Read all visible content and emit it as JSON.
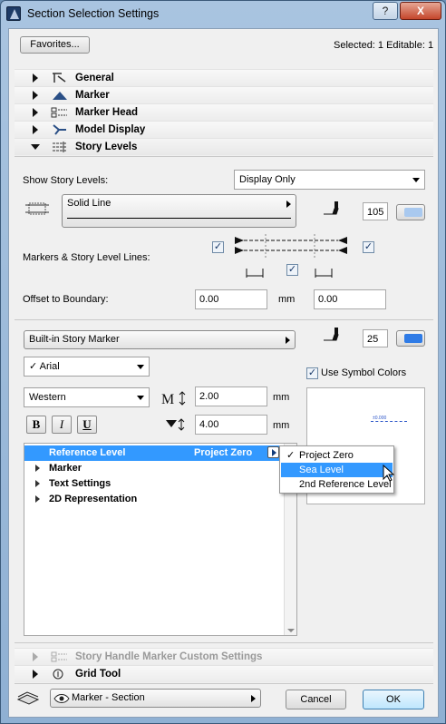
{
  "window": {
    "title": "Section Selection Settings",
    "help_label": "?",
    "close_label": "X"
  },
  "top": {
    "favorites_label": "Favorites...",
    "selection_info": "Selected: 1 Editable: 1"
  },
  "sections": {
    "general": "General",
    "marker": "Marker",
    "marker_head": "Marker Head",
    "model_display": "Model Display",
    "story_levels": "Story Levels",
    "story_handle": "Story Handle Marker Custom Settings",
    "grid_tool": "Grid Tool"
  },
  "story_levels": {
    "show_label": "Show Story Levels:",
    "show_value": "Display Only",
    "line_type": "Solid Line",
    "pen_number": "105",
    "markers_label": "Markers & Story Level Lines:",
    "offset_label": "Offset to Boundary:",
    "offset_left": "0.00",
    "offset_unit": "mm",
    "offset_right": "0.00"
  },
  "marker": {
    "marker_type": "Built-in Story Marker",
    "pen_number": "25",
    "font_name": "Arial",
    "font_check": "✓",
    "encoding": "Western",
    "size_value": "2.00",
    "size_unit": "mm",
    "offset_value": "4.00",
    "offset_unit": "mm",
    "bold": "B",
    "italic": "I",
    "underline": "U",
    "use_symbol_colors": "Use Symbol Colors",
    "preview_label": "±0.000"
  },
  "tree": {
    "rows": [
      {
        "label": "Reference Level",
        "value": "Project Zero"
      },
      {
        "label": "Marker"
      },
      {
        "label": "Text Settings"
      },
      {
        "label": "2D Representation"
      }
    ]
  },
  "menu": {
    "items": [
      {
        "label": "Project Zero",
        "check": "✓"
      },
      {
        "label": "Sea Level"
      },
      {
        "label": "2nd Reference Level"
      }
    ]
  },
  "bottom": {
    "layer_label": "Marker - Section",
    "cancel_label": "Cancel",
    "ok_label": "OK"
  }
}
